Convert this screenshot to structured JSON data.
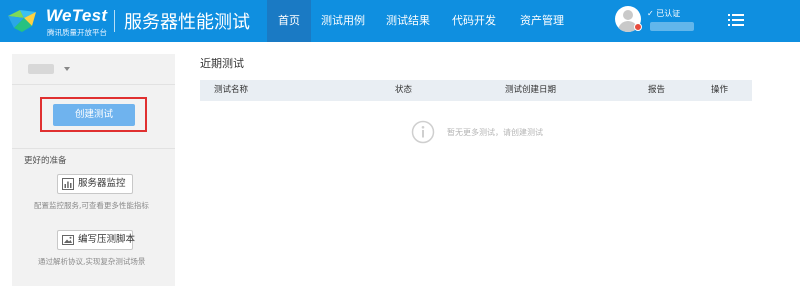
{
  "header": {
    "logo_text": "WeTest",
    "logo_subtitle": "腾讯质量开放平台",
    "app_title": "服务器性能测试",
    "nav": [
      {
        "label": "首页",
        "active": true
      },
      {
        "label": "测试用例",
        "active": false
      },
      {
        "label": "测试结果",
        "active": false
      },
      {
        "label": "代码开发",
        "active": false
      },
      {
        "label": "资产管理",
        "active": false
      }
    ],
    "user": {
      "verified_label": "✓ 已认证",
      "avatar_icon": "user-avatar-icon"
    },
    "menu_icon": "hamburger-menu-icon",
    "colors": {
      "bar": "#0f8fe0",
      "active_tab": "#1a7ac4"
    }
  },
  "sidebar": {
    "create_button": "创建测试",
    "prep_title": "更好的准备",
    "tools": [
      {
        "label": "服务器监控",
        "icon": "bar-chart-icon",
        "description": "配置监控服务,可查看更多性能指标"
      },
      {
        "label": "编写压测脚本",
        "icon": "script-image-icon",
        "description": "通过解析协议,实现复杂测试场景"
      }
    ]
  },
  "main": {
    "section_title": "近期测试",
    "table": {
      "columns": [
        "测试名称",
        "状态",
        "测试创建日期",
        "报告",
        "操作"
      ],
      "rows": []
    },
    "empty_state": {
      "icon": "info-circle-icon",
      "text": "暂无更多测试，请创建测试"
    }
  }
}
